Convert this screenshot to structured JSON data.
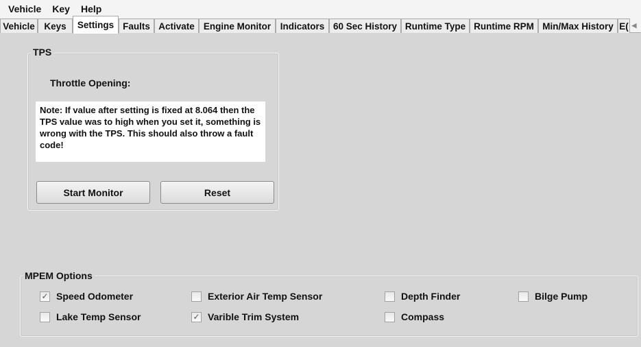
{
  "menu": [
    "Vehicle",
    "Key",
    "Help"
  ],
  "tabs": [
    "Vehicle",
    "Keys",
    "Settings",
    "Faults",
    "Activate",
    "Engine Monitor",
    "Indicators",
    "60 Sec History",
    "Runtime Type",
    "Runtime RPM",
    "Min/Max History",
    "E("
  ],
  "active_tab": "Settings",
  "tps": {
    "title": "TPS",
    "throttle_label": "Throttle Opening:",
    "note": "Note: If value after setting is fixed at 8.064 then the TPS value was to high when you set it, something is wrong with the TPS. This should also throw a fault code!",
    "start_label": "Start Monitor",
    "reset_label": "Reset"
  },
  "mpem": {
    "title": "MPEM Options",
    "options": [
      {
        "label": "Speed Odometer",
        "checked": true
      },
      {
        "label": "Exterior Air Temp Sensor",
        "checked": false
      },
      {
        "label": "Depth Finder",
        "checked": false
      },
      {
        "label": "Bilge Pump",
        "checked": false
      },
      {
        "label": "Lake Temp Sensor",
        "checked": false
      },
      {
        "label": "Varible Trim System",
        "checked": true
      },
      {
        "label": "Compass",
        "checked": false
      }
    ]
  }
}
